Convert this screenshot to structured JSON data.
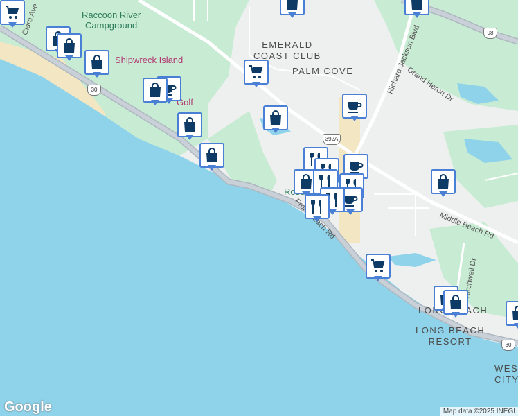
{
  "map": {
    "place_labels": [
      "EMERALD\nCOAST CLUB",
      "PALM COVE",
      "LONG BEACH",
      "LONG BEACH\nRESORT",
      "WEST\nCITY"
    ],
    "park_labels": [
      "Raccoon River\nCampground"
    ],
    "poi_labels": [
      "Shipwreck Island",
      "Golf",
      "Rosemary"
    ],
    "road_labels": [
      "Clara Ave",
      "Richard Jackson Blvd",
      "Grand Heron Dr",
      "Middle Beach Rd",
      "Front Beach Rd",
      "Kirchwell Dr"
    ],
    "route_shields": [
      "30",
      "98",
      "392A",
      "30"
    ],
    "markers": [
      {
        "type": "shopping-cart",
        "label": "supermarket"
      },
      {
        "type": "shopping-bag",
        "label": "shop"
      },
      {
        "type": "coffee",
        "label": "cafe"
      },
      {
        "type": "utensils",
        "label": "restaurant"
      }
    ]
  },
  "footer": {
    "logo": "Google",
    "attribution": "Map data ©2025 INEGI"
  },
  "colors": {
    "water": "#8fd3ea",
    "land": "#eef0f0",
    "park": "#c8ebd3",
    "road_major": "#b9c2cb",
    "sand": "#f2e6c3",
    "marker_border": "#4a7fd6",
    "marker_icon": "#0d3b66"
  }
}
